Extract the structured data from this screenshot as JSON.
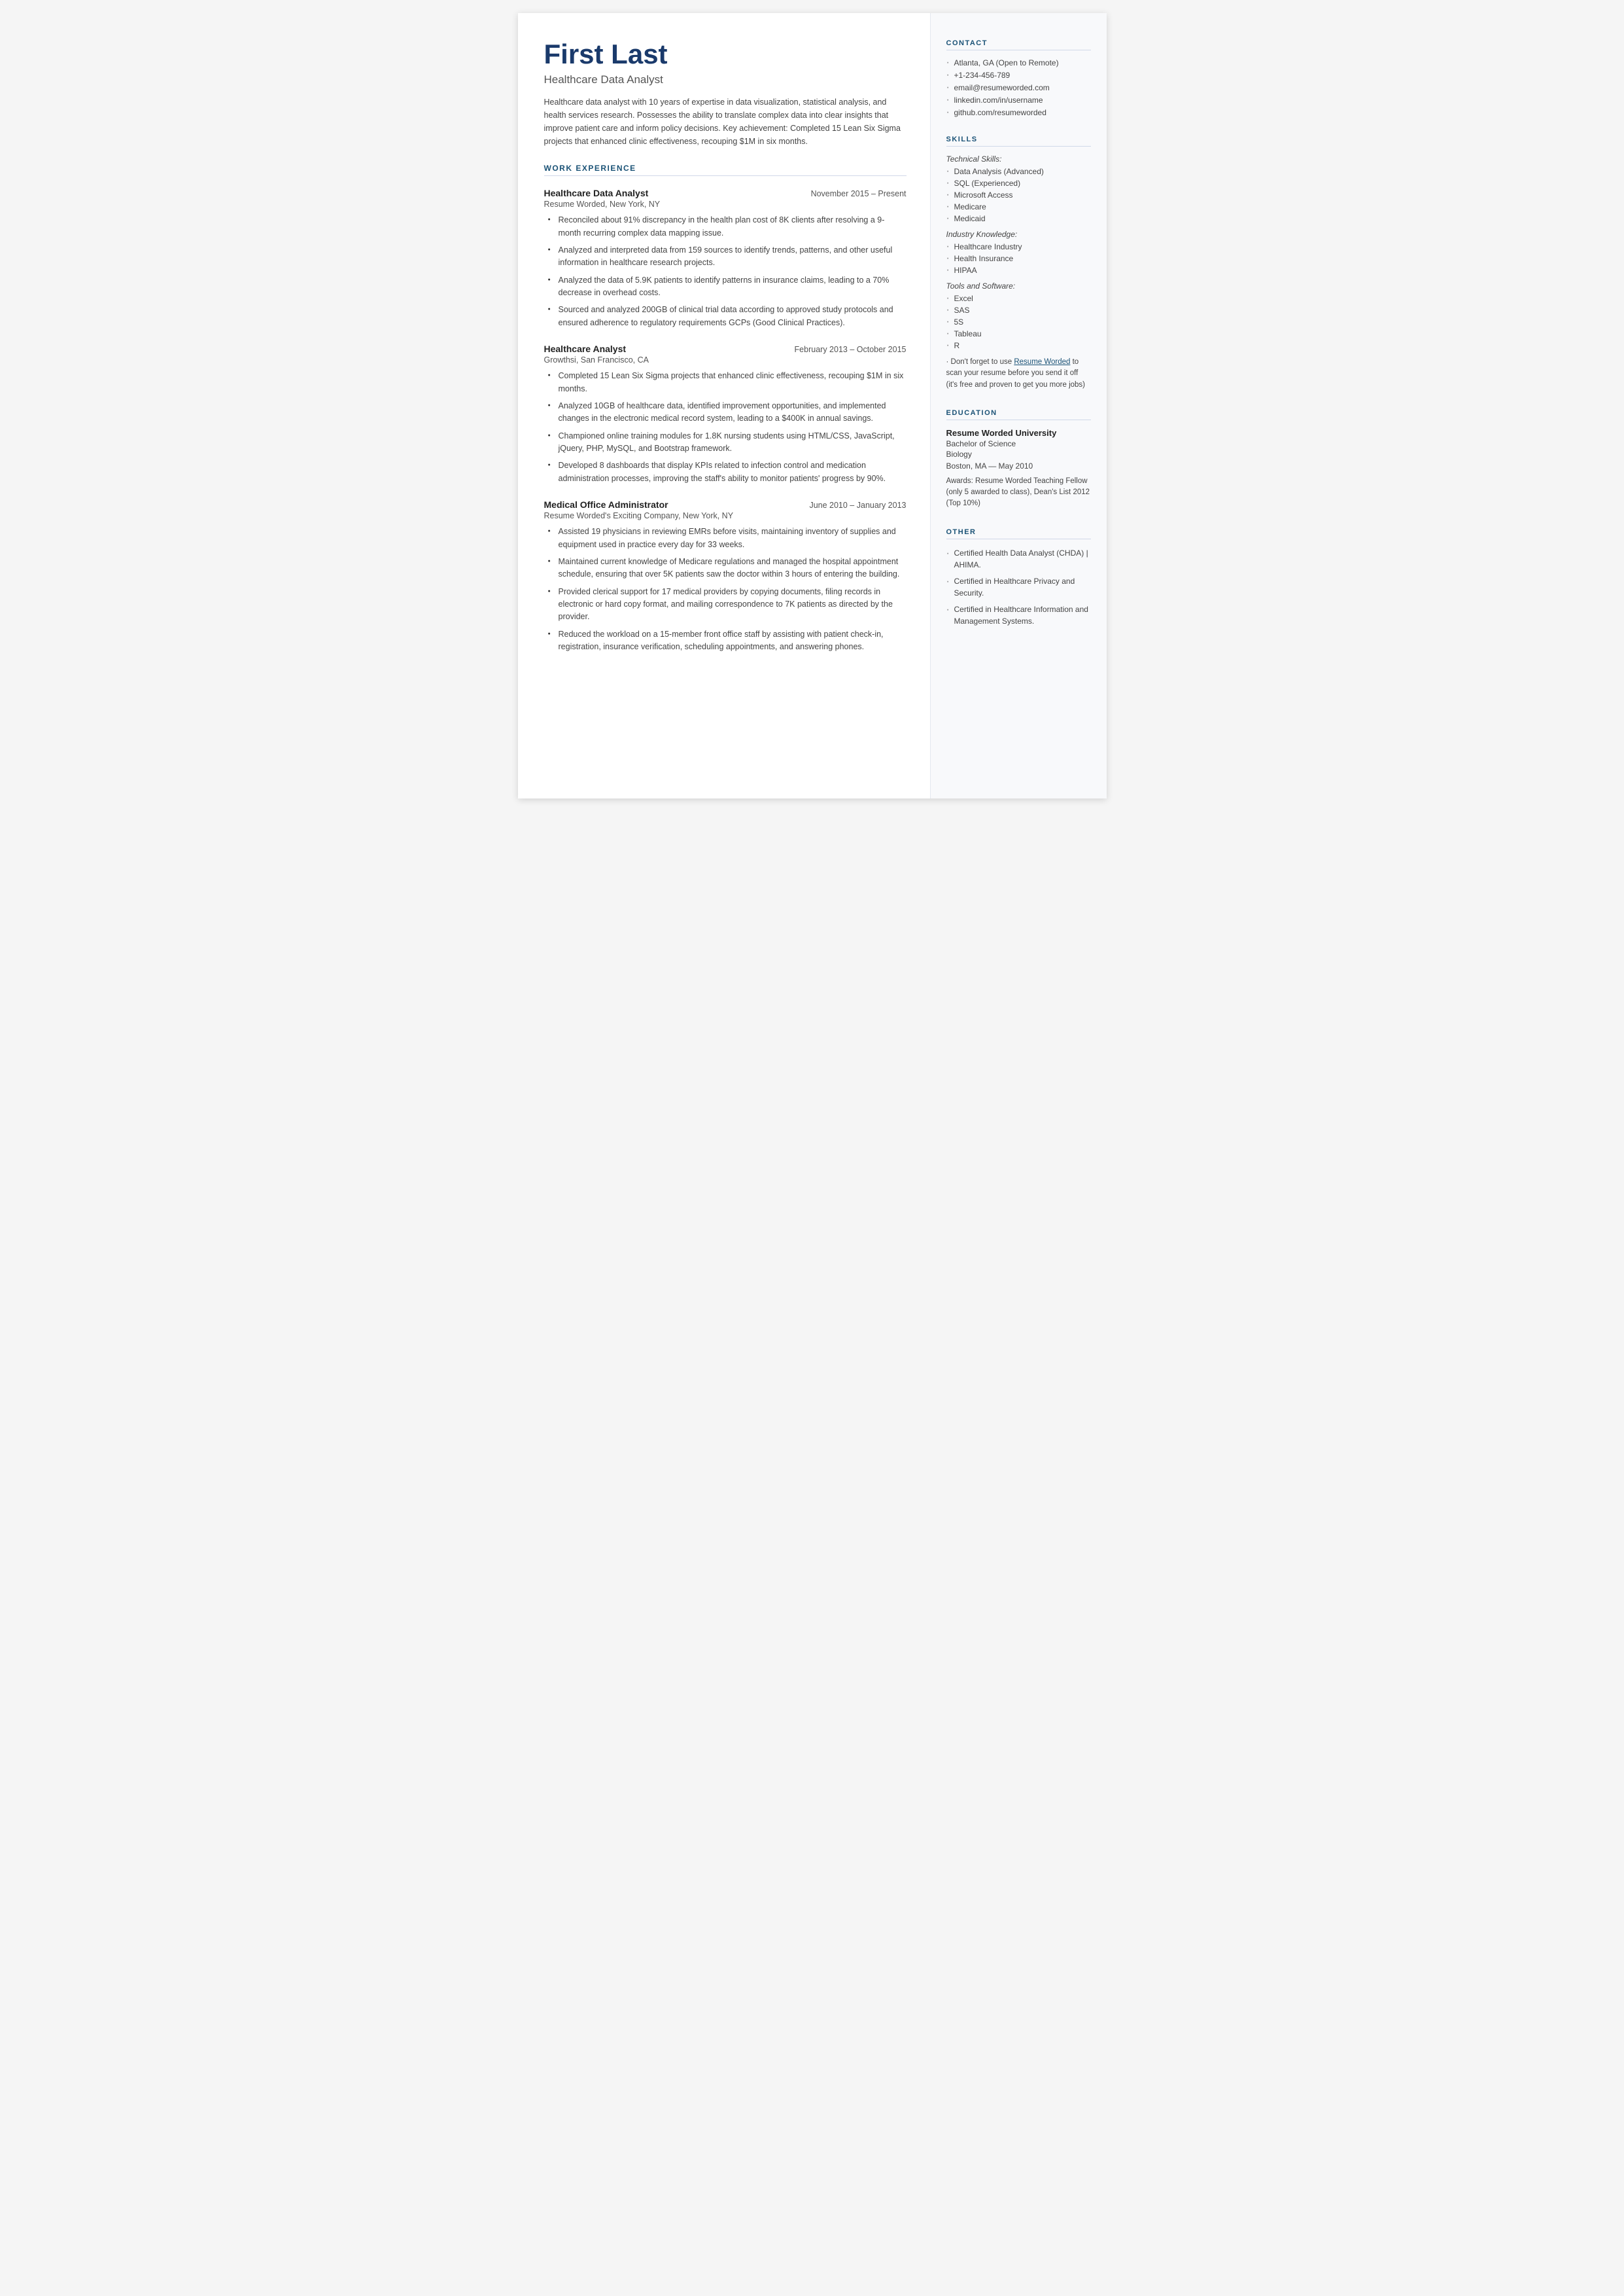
{
  "header": {
    "name": "First Last",
    "title": "Healthcare Data Analyst",
    "summary": "Healthcare data analyst with 10 years of expertise in data visualization, statistical analysis, and health services research. Possesses the ability to translate complex data into clear insights that improve patient care and inform policy decisions. Key achievement: Completed 15 Lean Six Sigma projects that enhanced clinic effectiveness, recouping $1M in six months."
  },
  "sections": {
    "work_experience_label": "WORK EXPERIENCE",
    "jobs": [
      {
        "title": "Healthcare Data Analyst",
        "dates": "November 2015 – Present",
        "company": "Resume Worded, New York, NY",
        "bullets": [
          "Reconciled about 91% discrepancy in the health plan cost of 8K clients after resolving a 9-month recurring complex data mapping issue.",
          "Analyzed and interpreted data from 159 sources to identify trends, patterns, and other useful information in healthcare research projects.",
          "Analyzed the data of 5.9K patients to identify patterns in insurance claims, leading to a 70% decrease in overhead costs.",
          "Sourced and analyzed 200GB of clinical trial data according to approved study protocols and ensured adherence to regulatory requirements GCPs (Good Clinical Practices)."
        ]
      },
      {
        "title": "Healthcare Analyst",
        "dates": "February 2013 – October 2015",
        "company": "Growthsi, San Francisco, CA",
        "bullets": [
          "Completed 15 Lean Six Sigma projects that enhanced clinic effectiveness, recouping $1M in six months.",
          "Analyzed 10GB of healthcare data, identified improvement opportunities, and implemented changes in the electronic medical record system, leading to a $400K in annual savings.",
          "Championed online training modules for 1.8K nursing students using HTML/CSS, JavaScript, jQuery, PHP, MySQL, and Bootstrap framework.",
          "Developed 8 dashboards that display KPIs related to infection control and medication administration processes, improving the staff's ability to monitor patients' progress by 90%."
        ]
      },
      {
        "title": "Medical Office Administrator",
        "dates": "June 2010 – January 2013",
        "company": "Resume Worded's Exciting Company, New York, NY",
        "bullets": [
          "Assisted 19 physicians in reviewing EMRs before visits, maintaining inventory of supplies and equipment used in practice every day for 33 weeks.",
          "Maintained current knowledge of Medicare regulations and managed the hospital appointment schedule, ensuring that over 5K patients saw the doctor within 3 hours of entering the building.",
          "Provided clerical support for 17 medical providers by copying documents, filing records in electronic or hard copy format, and mailing correspondence to 7K patients as directed by the provider.",
          "Reduced the workload on a 15-member front office staff by assisting with patient check-in, registration, insurance verification, scheduling appointments, and answering phones."
        ]
      }
    ]
  },
  "contact": {
    "label": "CONTACT",
    "items": [
      "Atlanta, GA (Open to Remote)",
      "+1-234-456-789",
      "email@resumeworded.com",
      "linkedin.com/in/username",
      "github.com/resumeworded"
    ]
  },
  "skills": {
    "label": "SKILLS",
    "technical_label": "Technical Skills:",
    "technical": [
      "Data Analysis (Advanced)",
      "SQL (Experienced)",
      "Microsoft Access",
      "Medicare",
      "Medicaid"
    ],
    "industry_label": "Industry Knowledge:",
    "industry": [
      "Healthcare Industry",
      "Health Insurance",
      "HIPAA"
    ],
    "tools_label": "Tools and Software:",
    "tools": [
      "Excel",
      "SAS",
      "5S",
      "Tableau",
      "R"
    ],
    "note": "· Don't forget to use Resume Worded to scan your resume before you send it off (it's free and proven to get you more jobs)"
  },
  "education": {
    "label": "EDUCATION",
    "school": "Resume Worded University",
    "degree": "Bachelor of Science",
    "field": "Biology",
    "location_date": "Boston, MA — May 2010",
    "awards": "Awards: Resume Worded Teaching Fellow (only 5 awarded to class), Dean's List 2012 (Top 10%)"
  },
  "other": {
    "label": "OTHER",
    "items": [
      "Certified Health Data Analyst (CHDA) | AHIMA.",
      "Certified in Healthcare Privacy and Security.",
      "Certified in Healthcare Information and Management Systems."
    ]
  }
}
